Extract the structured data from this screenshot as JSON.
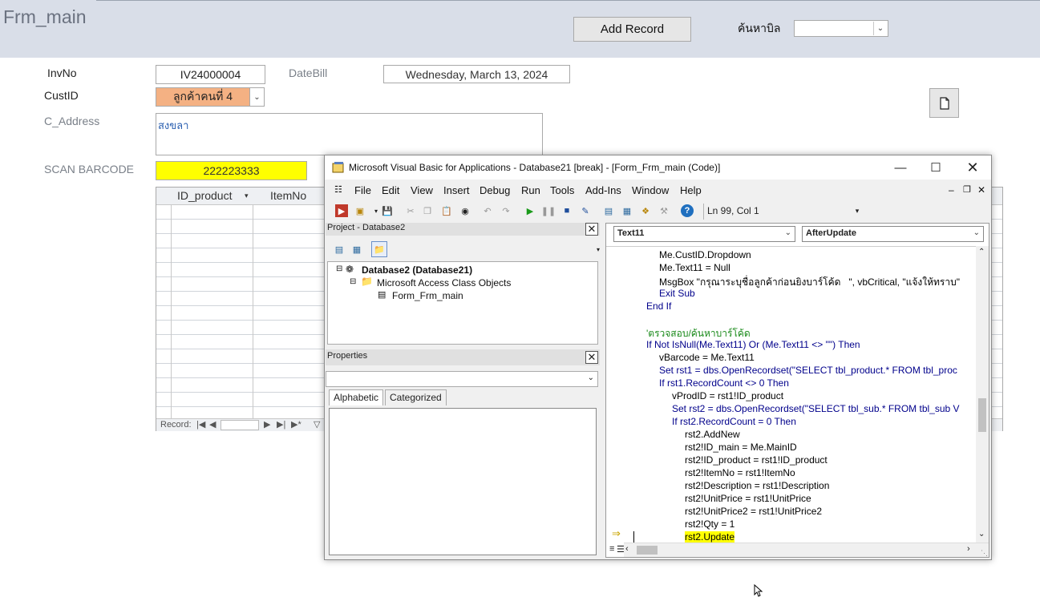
{
  "form": {
    "title": "Frm_main",
    "add_record_label": "Add Record",
    "search_label": "ค้นหาบิล",
    "search_value": "",
    "fields": {
      "invno_label": "InvNo",
      "invno_value": "IV24000004",
      "datebill_label": "DateBill",
      "datebill_value": "Wednesday, March 13, 2024",
      "custid_label": "CustID",
      "custid_value": "ลูกค้าคนที่ 4",
      "caddress_label": "C_Address",
      "caddress_value": "สงขลา",
      "scan_label": "SCAN BARCODE",
      "scan_value": "222223333"
    },
    "subform": {
      "columns": [
        "ID_product",
        "ItemNo"
      ],
      "record_nav_label": "Record:"
    }
  },
  "vba": {
    "title": "Microsoft Visual Basic for Applications - Database21 [break] - [Form_Frm_main (Code)]",
    "menu": [
      "File",
      "Edit",
      "View",
      "Insert",
      "Debug",
      "Run",
      "Tools",
      "Add-Ins",
      "Window",
      "Help"
    ],
    "status": "Ln 99, Col 1",
    "project": {
      "title": "Project - Database2",
      "root": "Database2 (Database21)",
      "folder": "Microsoft Access Class Objects",
      "module": "Form_Frm_main"
    },
    "properties": {
      "title": "Properties",
      "tabs": [
        "Alphabetic",
        "Categorized"
      ]
    },
    "code": {
      "object_combo": "Text11",
      "procedure_combo": "AfterUpdate",
      "lines": [
        "Me.CustID.Dropdown",
        "Me.Text11 = Null",
        "MsgBox \"กรุณาระบุชื่อลูกค้าก่อนยิงบาร์โค้ด   \", vbCritical, \"แจ้งให้ทราบ\"",
        "Exit Sub",
        "End If",
        "",
        "'ตรวจสอบ/ค้นหาบาร์โค้ด",
        "If Not IsNull(Me.Text11) Or (Me.Text11 <> \"\") Then",
        "vBarcode = Me.Text11",
        "Set rst1 = dbs.OpenRecordset(\"SELECT tbl_product.* FROM tbl_proc",
        "If rst1.RecordCount <> 0 Then",
        "vProdID = rst1!ID_product",
        "Set rst2 = dbs.OpenRecordset(\"SELECT tbl_sub.* FROM tbl_sub V",
        "If rst2.RecordCount = 0 Then",
        "rst2.AddNew",
        "rst2!ID_main = Me.MainID",
        "rst2!ID_product = rst1!ID_product",
        "rst2!ItemNo = rst1!ItemNo",
        "rst2!Description = rst1!Description",
        "rst2!UnitPrice = rst1!UnitPrice",
        "rst2!UnitPrice2 = rst1!UnitPrice2",
        "rst2!Qty = 1",
        "rst2.Update"
      ]
    }
  },
  "colors": {
    "header_bg": "#d9dee8",
    "custid_bg": "#f4b183",
    "scan_bg": "#ffff00",
    "code_keyword": "#00008b",
    "code_comment": "#1a8a1a",
    "exec_highlight": "#ffff00"
  },
  "icons": [
    "document-icon",
    "vba-app-icon",
    "minimize-icon",
    "maximize-icon",
    "close-icon",
    "arrow-pointer-icon",
    "mouse-cursor-icon"
  ]
}
